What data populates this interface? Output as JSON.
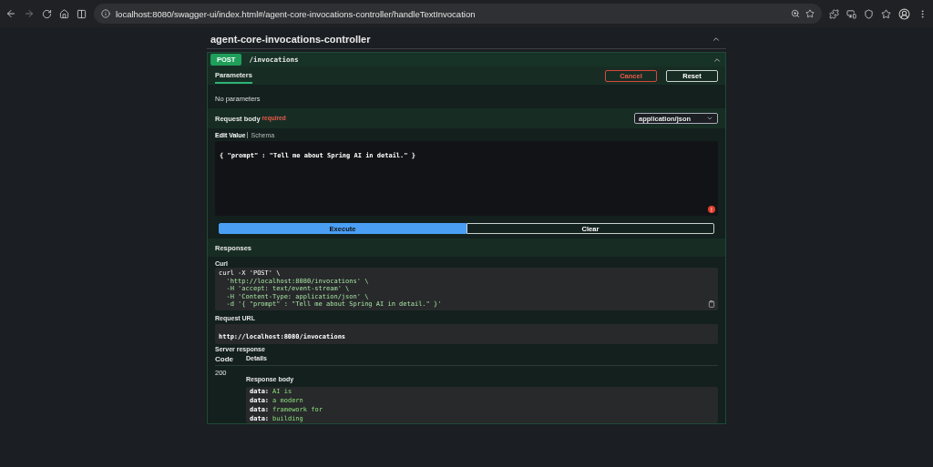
{
  "browser": {
    "url": "localhost:8080/swagger-ui/index.html#/agent-core-invocations-controller/handleTextInvocation"
  },
  "controller": {
    "title": "agent-core-invocations-controller",
    "expanded": true
  },
  "operation": {
    "method": "POST",
    "path": "/invocations",
    "expanded": true
  },
  "parameters": {
    "tab": "Parameters",
    "cancel": "Cancel",
    "reset": "Reset",
    "empty": "No parameters"
  },
  "request_body": {
    "label": "Request body",
    "required": "required",
    "content_type": "application/json",
    "tabs": [
      {
        "label": "Edit Value",
        "selected": true
      },
      {
        "label": "Schema",
        "selected": false
      }
    ],
    "value": "{ \"prompt\" : \"Tell me about Spring AI in detail.\" }",
    "error_count": "!"
  },
  "actions": {
    "execute": "Execute",
    "clear": "Clear"
  },
  "responses": {
    "title": "Responses",
    "curl_label": "Curl",
    "curl_lines": [
      "curl -X 'POST' \\",
      "  'http://localhost:8080/invocations' \\",
      "  -H 'accept: text/event-stream' \\",
      "  -H 'Content-Type: application/json' \\",
      "  -d '{ \"prompt\" : \"Tell me about Spring AI in detail.\" }'"
    ],
    "url_label": "Request URL",
    "url": "http://localhost:8080/invocations",
    "server_label": "Server response",
    "code_header": "Code",
    "details_header": "Details",
    "code": "200",
    "body_label": "Response body",
    "body_lines": [
      {
        "key": "data:",
        "value": "AI is"
      },
      {
        "key": "data:",
        "value": "a modern"
      },
      {
        "key": "data:",
        "value": "framework for"
      },
      {
        "key": "data:",
        "value": "building"
      }
    ]
  }
}
